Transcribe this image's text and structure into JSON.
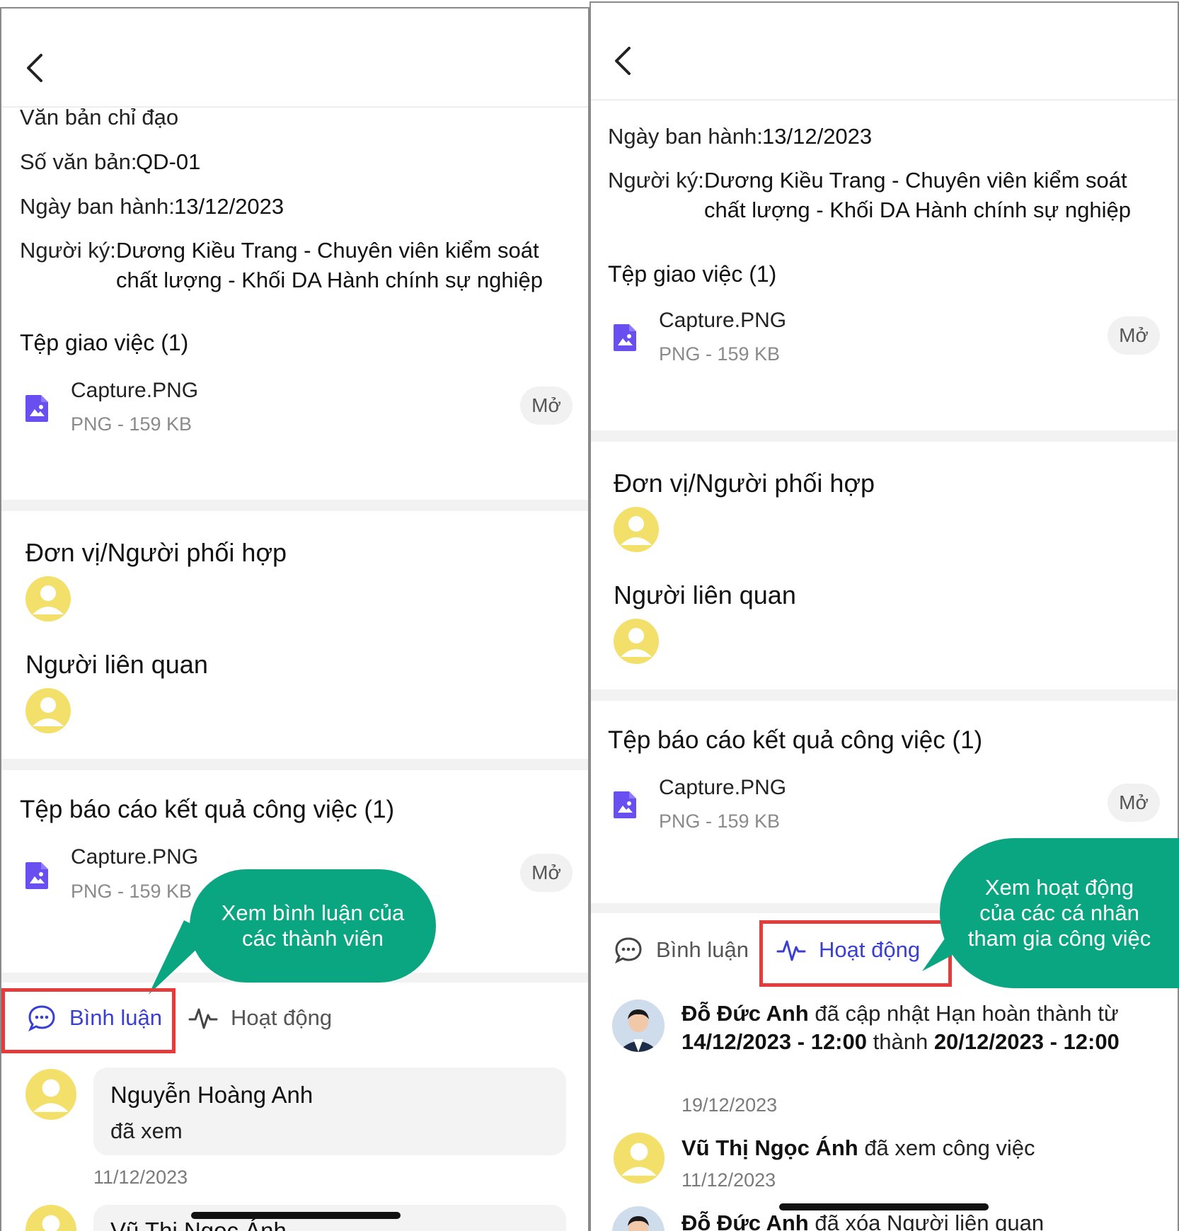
{
  "left": {
    "doc_type": "Văn bản chỉ đạo",
    "doc_number_label": "Số văn bản:",
    "doc_number_value": "QD-01",
    "issue_date_label": "Ngày ban hành:",
    "issue_date_value": "13/12/2023",
    "signer_label": "Người ký:",
    "signer_line1": "Dương Kiều Trang - Chuyên viên kiểm soát",
    "signer_line2": "chất lượng - Khối DA Hành chính sự nghiệp",
    "assign_files_title": "Tệp giao việc (1)",
    "file1_name": "Capture.PNG",
    "file1_meta": "PNG - 159 KB",
    "open_label": "Mở",
    "coordinator_title": "Đơn vị/Người phối hợp",
    "related_title": "Người liên quan",
    "report_files_title": "Tệp báo cáo kết quả công việc (1)",
    "file2_name": "Capture.PNG",
    "file2_meta": "PNG - 159 KB",
    "bubble_line1": "Xem bình luận của",
    "bubble_line2": "các thành viên",
    "tab_comments": "Bình luận",
    "tab_activity": "Hoạt động",
    "comment1_name": "Nguyễn Hoàng Anh",
    "comment1_text": "đã xem",
    "comment1_date": "11/12/2023",
    "comment2_name": "Vũ Thị Ngọc Ánh"
  },
  "right": {
    "issue_date_label": "Ngày ban hành:",
    "issue_date_value": "13/12/2023",
    "signer_label": "Người ký:",
    "signer_line1": "Dương Kiều Trang - Chuyên viên kiểm soát",
    "signer_line2": "chất lượng - Khối DA Hành chính sự nghiệp",
    "assign_files_title": "Tệp giao việc (1)",
    "file1_name": "Capture.PNG",
    "file1_meta": "PNG - 159 KB",
    "open_label": "Mở",
    "coordinator_title": "Đơn vị/Người phối hợp",
    "related_title": "Người liên quan",
    "report_files_title": "Tệp báo cáo kết quả công việc (1)",
    "file2_name": "Capture.PNG",
    "file2_meta": "PNG - 159 KB",
    "bubble_line1": "Xem hoạt động",
    "bubble_line2": "của các cá nhân",
    "bubble_line3": "tham gia công việc",
    "tab_comments": "Bình luận",
    "tab_activity": "Hoạt động",
    "activity1": {
      "actor": "Đỗ Đức Anh",
      "text_a": " đã cập nhật Hạn hoàn thành từ ",
      "from": "14/12/2023 - 12:00",
      "text_b": " thành ",
      "to": "20/12/2023 - 12:00",
      "date": "19/12/2023"
    },
    "activity2": {
      "actor": "Vũ Thị Ngọc Ánh",
      "text": " đã xem công việc",
      "date": "11/12/2023"
    },
    "activity3": {
      "actor": "Đỗ Đức Anh",
      "text": " đã xóa Người liên quan"
    }
  },
  "colors": {
    "accent": "#3a3fd4",
    "highlight": "#e53b3b",
    "bubble": "#0aa682",
    "avatar": "#f2e06a",
    "file_icon": "#6a4ff0"
  },
  "icons": [
    "back-chevron-icon",
    "image-file-icon",
    "user-avatar-icon",
    "comment-icon",
    "activity-icon"
  ]
}
